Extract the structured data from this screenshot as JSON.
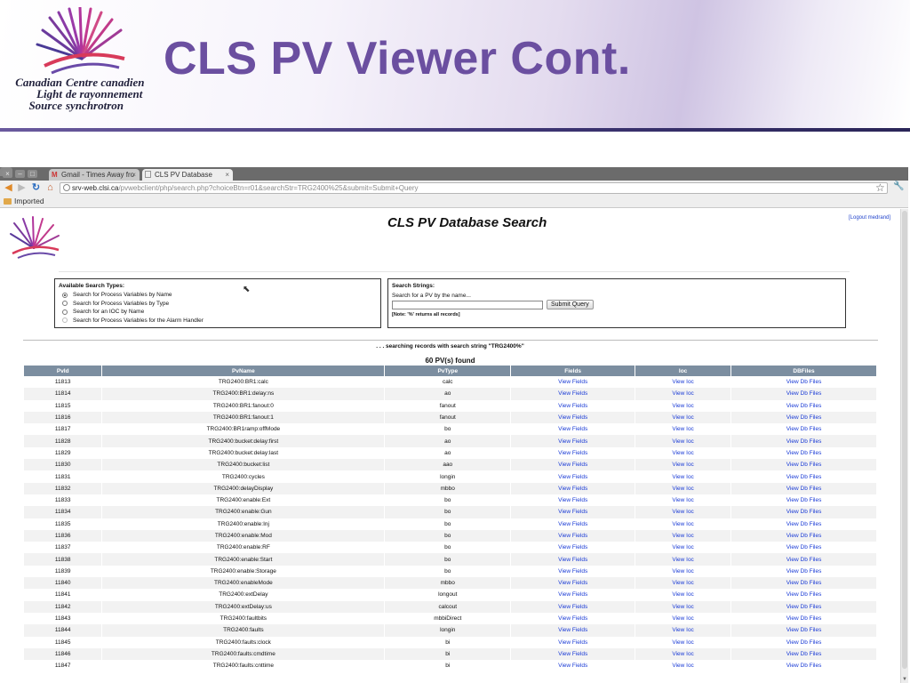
{
  "slide": {
    "title": "CLS PV Viewer Cont.",
    "logo": {
      "en_line1": "Canadian",
      "en_line2": "Light",
      "en_line3": "Source",
      "fr_line1": "Centre canadien",
      "fr_line2": "de rayonnement",
      "fr_line3": "synchrotron"
    }
  },
  "browser": {
    "tabs": [
      {
        "label": "Gmail - Times Away fro",
        "icon": "gmail-icon"
      },
      {
        "label": "CLS PV Database",
        "icon": "page-icon"
      }
    ],
    "url_host": "srv-web.clsi.ca",
    "url_path": "/pvwebclient/php/search.php?choiceBtn=r01&searchStr=TRG2400%25&submit=Submit+Query",
    "bookmark": "Imported"
  },
  "page": {
    "title": "CLS PV Database Search",
    "logout": "[Logout medrand]",
    "search_types": {
      "heading": "Available Search Types:",
      "options": [
        "Search for Process Variables by Name",
        "Search for Process Variables by Type",
        "Search for an IOC by Name",
        "Search for Process Variables for the Alarm Handler"
      ],
      "selected": 0
    },
    "search_strings": {
      "heading": "Search Strings:",
      "label": "Search for a PV by the name...",
      "input_value": "",
      "submit_label": "Submit Query",
      "note": "[Note: '%' returns all records]"
    },
    "status": ". . . searching records with search string \"TRG2400%\"",
    "found": "60 PV(s) found",
    "table": {
      "headers": [
        "PvId",
        "PvName",
        "PvType",
        "Fields",
        "Ioc",
        "DBFiles"
      ],
      "link_fields": "View Fields",
      "link_ioc": "View Ioc",
      "link_db": "View Db Files",
      "rows": [
        [
          "11813",
          "TRG2400:BR1:calc",
          "calc"
        ],
        [
          "11814",
          "TRG2400:BR1:delay:ns",
          "ao"
        ],
        [
          "11815",
          "TRG2400:BR1:fanout:0",
          "fanout"
        ],
        [
          "11816",
          "TRG2400:BR1:fanout:1",
          "fanout"
        ],
        [
          "11817",
          "TRG2400:BR1ramp:offMode",
          "bo"
        ],
        [
          "11828",
          "TRG2400:bucket:delay:first",
          "ao"
        ],
        [
          "11829",
          "TRG2400:bucket:delay:last",
          "ao"
        ],
        [
          "11830",
          "TRG2400:bucket:list",
          "aao"
        ],
        [
          "11831",
          "TRG2400:cycles",
          "longin"
        ],
        [
          "11832",
          "TRG2400:delayDisplay",
          "mbbo"
        ],
        [
          "11833",
          "TRG2400:enable:Ext",
          "bo"
        ],
        [
          "11834",
          "TRG2400:enable:Gun",
          "bo"
        ],
        [
          "11835",
          "TRG2400:enable:Inj",
          "bo"
        ],
        [
          "11836",
          "TRG2400:enable:Mod",
          "bo"
        ],
        [
          "11837",
          "TRG2400:enable:RF",
          "bo"
        ],
        [
          "11838",
          "TRG2400:enable:Start",
          "bo"
        ],
        [
          "11839",
          "TRG2400:enable:Storage",
          "bo"
        ],
        [
          "11840",
          "TRG2400:enableMode",
          "mbbo"
        ],
        [
          "11841",
          "TRG2400:extDelay",
          "longout"
        ],
        [
          "11842",
          "TRG2400:extDelay:us",
          "calcout"
        ],
        [
          "11843",
          "TRG2400:faultbits",
          "mbbiDirect"
        ],
        [
          "11844",
          "TRG2400:faults",
          "longin"
        ],
        [
          "11845",
          "TRG2400:faults:clock",
          "bi"
        ],
        [
          "11846",
          "TRG2400:faults:cmdtime",
          "bi"
        ],
        [
          "11847",
          "TRG2400:faults:cnttime",
          "bi"
        ]
      ]
    }
  },
  "colors": {
    "title": "#6b4fa0",
    "table_header": "#7c8ea0",
    "link": "#1a3bd6"
  }
}
